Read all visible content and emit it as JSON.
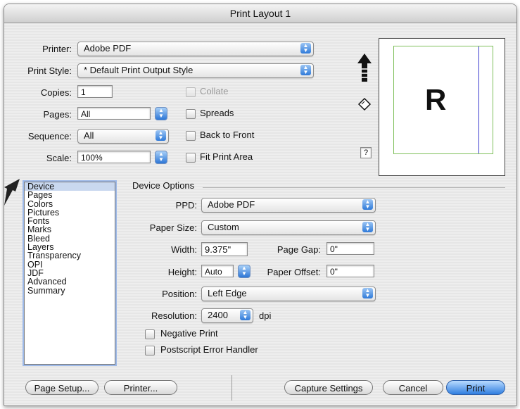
{
  "window": {
    "title": "Print Layout 1"
  },
  "top": {
    "printer_label": "Printer:",
    "printer_value": "Adobe PDF",
    "print_style_label": "Print Style:",
    "print_style_value": "* Default Print Output Style",
    "copies_label": "Copies:",
    "copies_value": "1",
    "pages_label": "Pages:",
    "pages_value": "All",
    "sequence_label": "Sequence:",
    "sequence_value": "All",
    "scale_label": "Scale:",
    "scale_value": "100%",
    "collate_label": "Collate",
    "spreads_label": "Spreads",
    "back_to_front_label": "Back to Front",
    "fit_print_area_label": "Fit Print Area",
    "help_label": "?"
  },
  "preview": {
    "page_letter": "R"
  },
  "sidebar": {
    "items": [
      "Device",
      "Pages",
      "Colors",
      "Pictures",
      "Fonts",
      "Marks",
      "Bleed",
      "Layers",
      "Transparency",
      "OPI",
      "JDF",
      "Advanced",
      "Summary"
    ],
    "selected": "Device"
  },
  "device_options": {
    "group_title": "Device Options",
    "ppd_label": "PPD:",
    "ppd_value": "Adobe PDF",
    "paper_size_label": "Paper Size:",
    "paper_size_value": "Custom",
    "width_label": "Width:",
    "width_value": "9.375\"",
    "page_gap_label": "Page Gap:",
    "page_gap_value": "0\"",
    "height_label": "Height:",
    "height_value": "Auto",
    "paper_offset_label": "Paper Offset:",
    "paper_offset_value": "0\"",
    "position_label": "Position:",
    "position_value": "Left Edge",
    "resolution_label": "Resolution:",
    "resolution_value": "2400",
    "resolution_unit": "dpi",
    "negative_print_label": "Negative Print",
    "postscript_error_label": "Postscript Error Handler"
  },
  "buttons": {
    "page_setup": "Page Setup...",
    "printer": "Printer...",
    "capture_settings": "Capture Settings",
    "cancel": "Cancel",
    "print": "Print"
  }
}
